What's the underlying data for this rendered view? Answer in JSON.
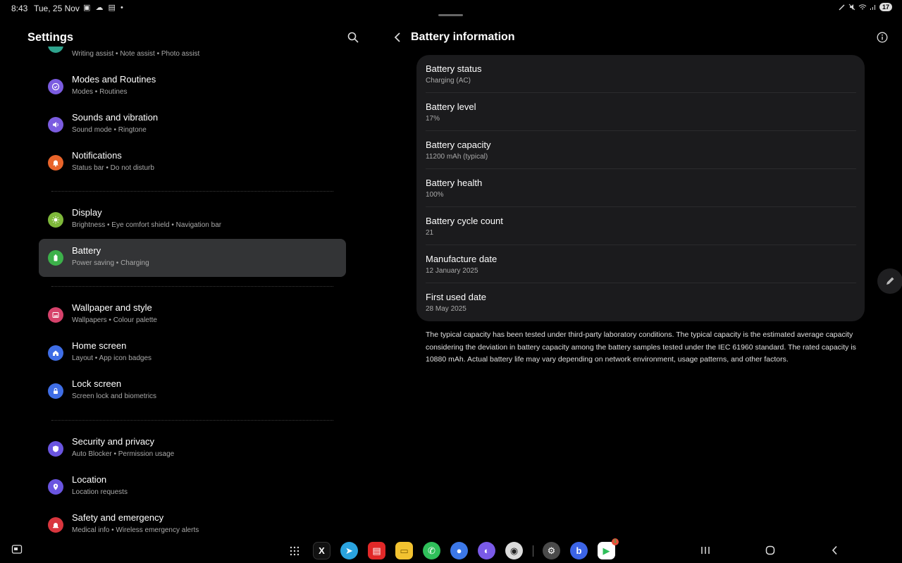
{
  "status_bar": {
    "time": "8:43",
    "date": "Tue, 25 Nov",
    "notification_icons": "▣ ☁ ▤ •",
    "battery_percent": "17"
  },
  "settings": {
    "title": "Settings",
    "partial_top_subtitle": "Writing assist  •  Note assist  •  Photo assist",
    "items": [
      {
        "title": "Modes and Routines",
        "subtitle": "Modes  •  Routines",
        "icon": "check-circle-icon",
        "color": "#7b5ce0"
      },
      {
        "title": "Sounds and vibration",
        "subtitle": "Sound mode  •  Ringtone",
        "icon": "speaker-icon",
        "color": "#7b5ce0"
      },
      {
        "title": "Notifications",
        "subtitle": "Status bar  •  Do not disturb",
        "icon": "bell-icon",
        "color": "#e8642a"
      },
      {
        "title": "Display",
        "subtitle": "Brightness  •  Eye comfort shield  •  Navigation bar",
        "icon": "sun-icon",
        "color": "#7eb83a"
      },
      {
        "title": "Battery",
        "subtitle": "Power saving  •  Charging",
        "icon": "battery-icon",
        "color": "#3cb14a",
        "active": true
      },
      {
        "title": "Wallpaper and style",
        "subtitle": "Wallpapers  •  Colour palette",
        "icon": "image-icon",
        "color": "#d6426b"
      },
      {
        "title": "Home screen",
        "subtitle": "Layout  •  App icon badges",
        "icon": "home-icon",
        "color": "#3f6ee6"
      },
      {
        "title": "Lock screen",
        "subtitle": "Screen lock and biometrics",
        "icon": "lock-icon",
        "color": "#3f6ee6"
      },
      {
        "title": "Security and privacy",
        "subtitle": "Auto Blocker  •  Permission usage",
        "icon": "shield-icon",
        "color": "#6a55e0"
      },
      {
        "title": "Location",
        "subtitle": "Location requests",
        "icon": "location-pin-icon",
        "color": "#6a55e0"
      },
      {
        "title": "Safety and emergency",
        "subtitle": "Medical info  •  Wireless emergency alerts",
        "icon": "siren-icon",
        "color": "#d9363e"
      }
    ]
  },
  "battery_info": {
    "title": "Battery information",
    "rows": [
      {
        "label": "Battery status",
        "value": "Charging (AC)"
      },
      {
        "label": "Battery level",
        "value": "17%"
      },
      {
        "label": "Battery capacity",
        "value": "11200 mAh (typical)"
      },
      {
        "label": "Battery health",
        "value": "100%"
      },
      {
        "label": "Battery cycle count",
        "value": "21"
      },
      {
        "label": "Manufacture date",
        "value": "12 January 2025"
      },
      {
        "label": "First used date",
        "value": "28 May 2025"
      }
    ],
    "note": "The typical capacity has been tested under third-party laboratory conditions. The typical capacity is the estimated average capacity considering the deviation in battery capacity among the battery samples tested under the IEC 61960 standard. The rated capacity is 10880 mAh. Actual battery life may vary depending on network environment, usage patterns, and other factors."
  },
  "taskbar": {
    "apps": [
      {
        "name": "app-drawer-icon",
        "glyph": "",
        "color": "transparent"
      },
      {
        "name": "x-app-icon",
        "glyph": "X",
        "color": "#111111"
      },
      {
        "name": "telegram-icon",
        "glyph": "➤",
        "color": "#2aa3df"
      },
      {
        "name": "flipboard-icon",
        "glyph": "▤",
        "color": "#e12828"
      },
      {
        "name": "files-icon",
        "glyph": "▭",
        "color": "#f2c230"
      },
      {
        "name": "phone-icon",
        "glyph": "✆",
        "color": "#2fbf5a"
      },
      {
        "name": "messages-icon",
        "glyph": "●",
        "color": "#3c78e8"
      },
      {
        "name": "internet-icon",
        "glyph": "◐",
        "color": "#7a5ae8"
      },
      {
        "name": "camera-icon",
        "glyph": "◉",
        "color": "#dcdcdc"
      },
      {
        "name": "settings-app-icon",
        "glyph": "⚙",
        "color": "#4a4a4a"
      },
      {
        "name": "bixby-icon",
        "glyph": "b",
        "color": "#3c64e6"
      },
      {
        "name": "play-store-icon",
        "glyph": "▶",
        "color": "#ffffff",
        "badge": "1"
      }
    ]
  }
}
